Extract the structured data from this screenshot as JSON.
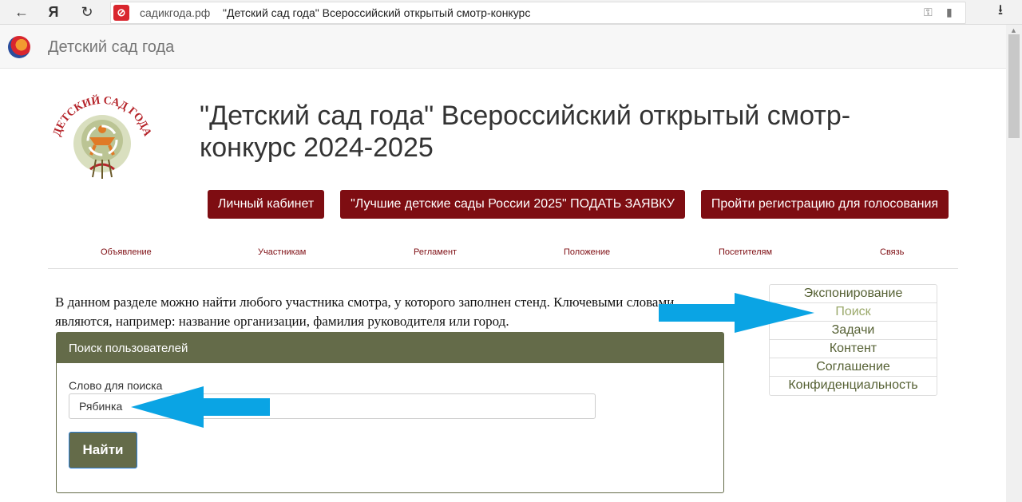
{
  "browser": {
    "back_icon": "←",
    "yandex_icon": "Я",
    "reload_icon": "↻",
    "domain": "садикгода.рф",
    "page_title": "\"Детский сад года\" Всероссийский открытый смотр-конкурс",
    "download_icon": "⭳"
  },
  "site_header": {
    "title": "Детский сад года"
  },
  "logo": {
    "text": "ДЕТСКИЙ САД ГОДА"
  },
  "main": {
    "title": "\"Детский сад года\" Всероссийский открытый смотр-конкурс 2024-2025",
    "buttons": {
      "cabinet": "Личный кабинет",
      "apply": "\"Лучшие детские сады России 2025\" ПОДАТЬ ЗАЯВКУ",
      "register": "Пройти регистрацию для голосования"
    }
  },
  "menu": {
    "items": [
      "Объявление",
      "Участникам",
      "Регламент",
      "Положение",
      "Посетителям",
      "Связь"
    ]
  },
  "intro_text": "В данном разделе можно найти любого участника смотра, у которого заполнен стенд. Ключевыми словами являются, например:  название организации, фамилия руководителя или город.",
  "search_panel": {
    "header": "Поиск пользователей",
    "field_label": "Слово для поиска",
    "input_value": "Рябинка",
    "submit_label": "Найти"
  },
  "side_menu": {
    "items": [
      "Экспонирование",
      "Поиск",
      "Задачи",
      "Контент",
      "Соглашение",
      "Конфиденциальность"
    ],
    "active": "Поиск"
  },
  "colors": {
    "accent_red": "#7e0d12",
    "panel_olive": "#646b49",
    "annotation_arrow": "#0aa4e4"
  }
}
